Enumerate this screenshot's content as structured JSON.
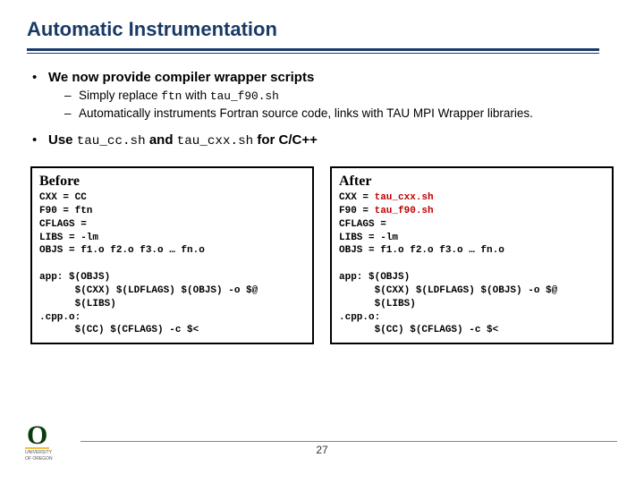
{
  "title": "Automatic Instrumentation",
  "bullets": {
    "b1": "We now provide compiler wrapper scripts",
    "b1a_pre": "Simply replace ",
    "b1a_code1": "ftn",
    "b1a_mid": " with ",
    "b1a_code2": "tau_f90.sh",
    "b1b": "Automatically instruments Fortran source code, links with TAU MPI Wrapper libraries.",
    "b2_pre": "Use ",
    "b2_code1": "tau_cc.sh",
    "b2_mid": " and ",
    "b2_code2": "tau_cxx.sh",
    "b2_post": " for C/C++"
  },
  "before": {
    "title": "Before",
    "l1": "CXX = CC",
    "l2": "F90 = ftn",
    "l3": "CFLAGS =",
    "l4": "LIBS = -lm",
    "l5": "OBJS = f1.o f2.o f3.o … fn.o",
    "l6": "",
    "l7": "app: $(OBJS)",
    "l8": "      $(CXX) $(LDFLAGS) $(OBJS) -o $@",
    "l9": "      $(LIBS)",
    "l10": ".cpp.o:",
    "l11": "      $(CC) $(CFLAGS) -c $<"
  },
  "after": {
    "title": "After",
    "l1a": "CXX = ",
    "l1b": "tau_cxx.sh",
    "l2a": "F90 = ",
    "l2b": "tau_f90.sh",
    "l3": "CFLAGS =",
    "l4": "LIBS = -lm",
    "l5": "OBJS = f1.o f2.o f3.o … fn.o",
    "l6": "",
    "l7": "app: $(OBJS)",
    "l8": "      $(CXX) $(LDFLAGS) $(OBJS) -o $@",
    "l9": "      $(LIBS)",
    "l10": ".cpp.o:",
    "l11": "      $(CC) $(CFLAGS) -c $<"
  },
  "page_number": "27",
  "logo": {
    "letter": "O",
    "sub1": "UNIVERSITY",
    "sub2": "OF OREGON"
  }
}
